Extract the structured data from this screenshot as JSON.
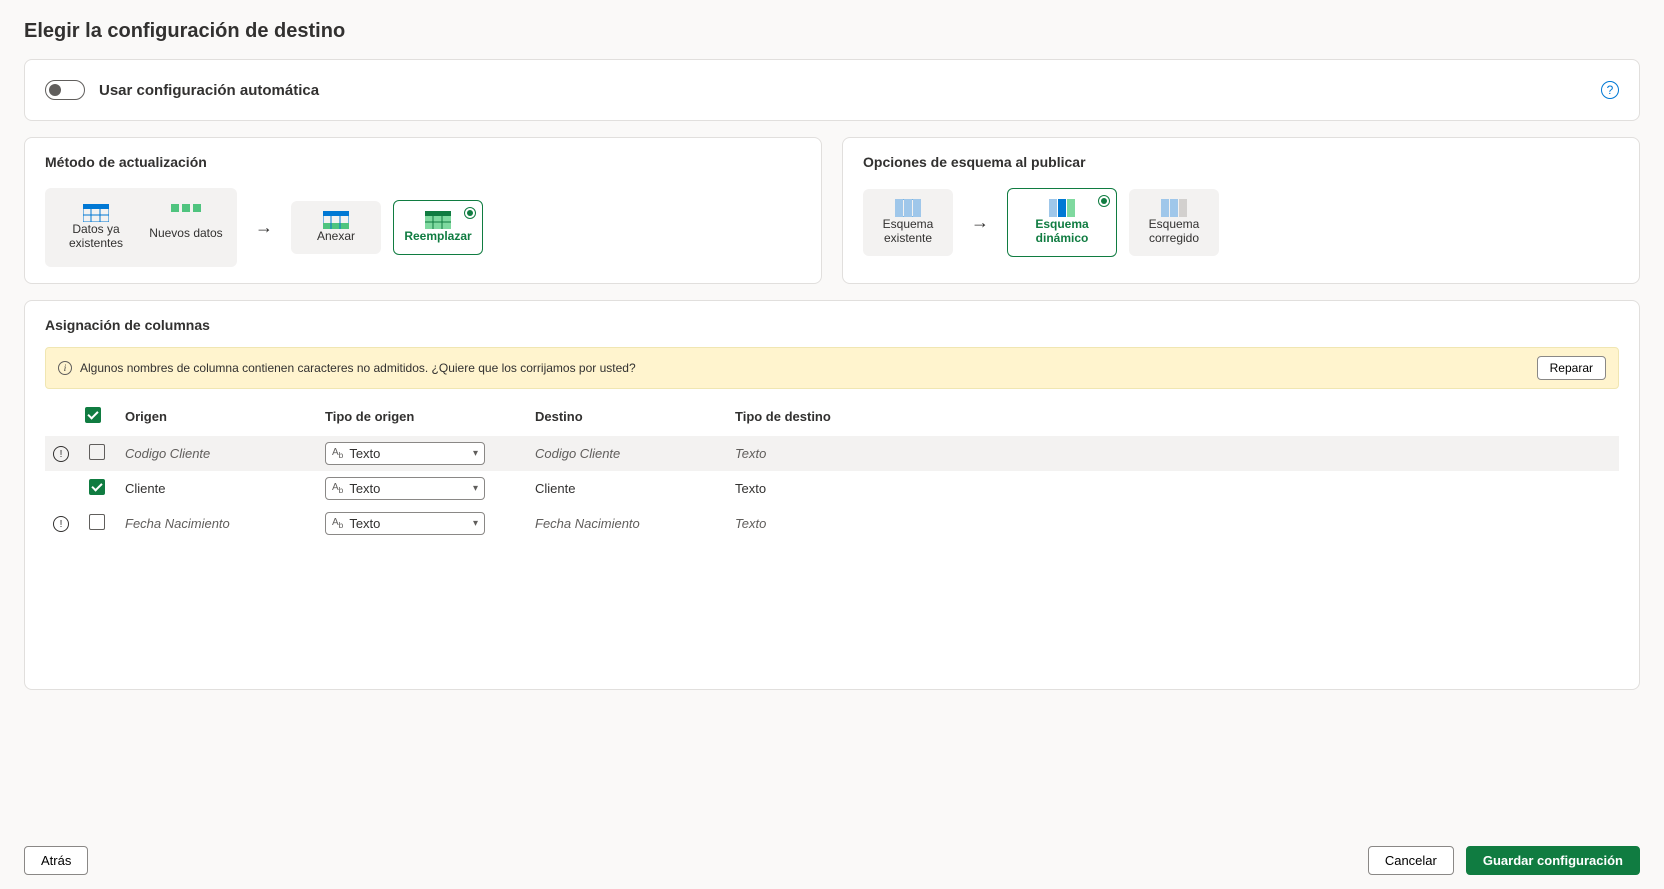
{
  "page": {
    "title": "Elegir la configuración de destino"
  },
  "auto_config": {
    "label": "Usar configuración automática",
    "enabled": false
  },
  "update_method": {
    "title": "Método de actualización",
    "existing_label": "Datos ya existentes",
    "new_label": "Nuevos datos",
    "append_label": "Anexar",
    "replace_label": "Reemplazar",
    "selected": "replace"
  },
  "schema_options": {
    "title": "Opciones de esquema al publicar",
    "existing_label": "Esquema existente",
    "dynamic_label": "Esquema dinámico",
    "fixed_label": "Esquema corregido",
    "selected": "dynamic"
  },
  "column_mapping": {
    "title": "Asignación de columnas",
    "warning_text": "Algunos nombres de columna contienen caracteres no admitidos. ¿Quiere que los corrijamos por usted?",
    "repair_label": "Reparar",
    "headers": {
      "origin": "Origen",
      "origin_type": "Tipo de origen",
      "destination": "Destino",
      "destination_type": "Tipo de destino"
    },
    "type_text": "Texto",
    "rows": [
      {
        "has_error": true,
        "checked": false,
        "origin": "Codigo Cliente",
        "origin_type": "Texto",
        "destination": "Codigo Cliente",
        "destination_type": "Texto",
        "italic": true
      },
      {
        "has_error": false,
        "checked": true,
        "origin": "Cliente",
        "origin_type": "Texto",
        "destination": "Cliente",
        "destination_type": "Texto",
        "italic": false
      },
      {
        "has_error": true,
        "checked": false,
        "origin": "Fecha Nacimiento",
        "origin_type": "Texto",
        "destination": "Fecha Nacimiento",
        "destination_type": "Texto",
        "italic": true
      }
    ]
  },
  "footer": {
    "back": "Atrás",
    "cancel": "Cancelar",
    "save": "Guardar configuración"
  }
}
